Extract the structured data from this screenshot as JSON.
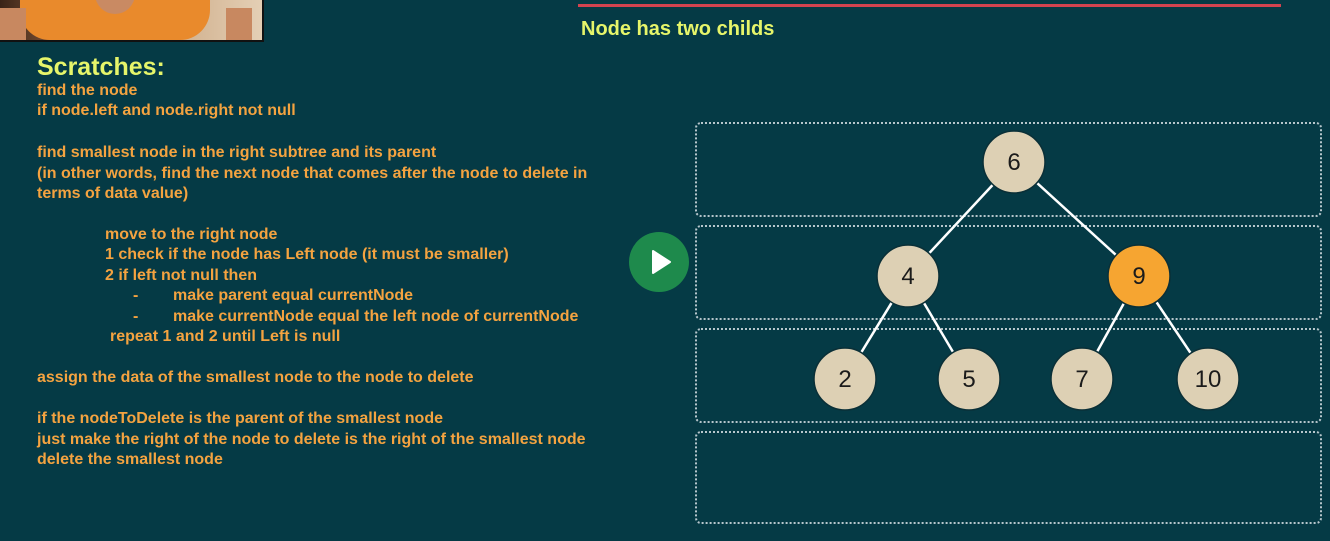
{
  "slide": {
    "title": "Node has two childs",
    "heading": "Scratches:",
    "notes": [
      "find the node",
      "if node.left and node.right not null",
      "find smallest node in the right subtree and its parent",
      "(in other words, find the next node that comes after the node to delete in",
      "terms of data value)",
      "move to the right node",
      "1 check if the node has Left node (it must be smaller)",
      "2 if left not null then",
      "-",
      "make parent equal currentNode",
      "-",
      "make currentNode equal the left node of currentNode",
      "repeat 1 and 2 until Left is null",
      "assign the data of the smallest node to the node to delete",
      "if the nodeToDelete is the parent of the smallest node",
      "just make the right of the node to delete is the right of the smallest node",
      "delete the smallest node"
    ]
  },
  "tree": {
    "nodes": [
      {
        "label": "6",
        "highlighted": false
      },
      {
        "label": "4",
        "highlighted": false
      },
      {
        "label": "9",
        "highlighted": true
      },
      {
        "label": "2",
        "highlighted": false
      },
      {
        "label": "5",
        "highlighted": false
      },
      {
        "label": "7",
        "highlighted": false
      },
      {
        "label": "10",
        "highlighted": false
      }
    ]
  },
  "colors": {
    "background": "#053a45",
    "title": "#e6f56a",
    "notes": "#f4a340",
    "node_fill": "#ddd0b4",
    "highlight_fill": "#f6a531",
    "play_button": "#1e8a4c"
  },
  "icons": {
    "play": "play-icon"
  }
}
